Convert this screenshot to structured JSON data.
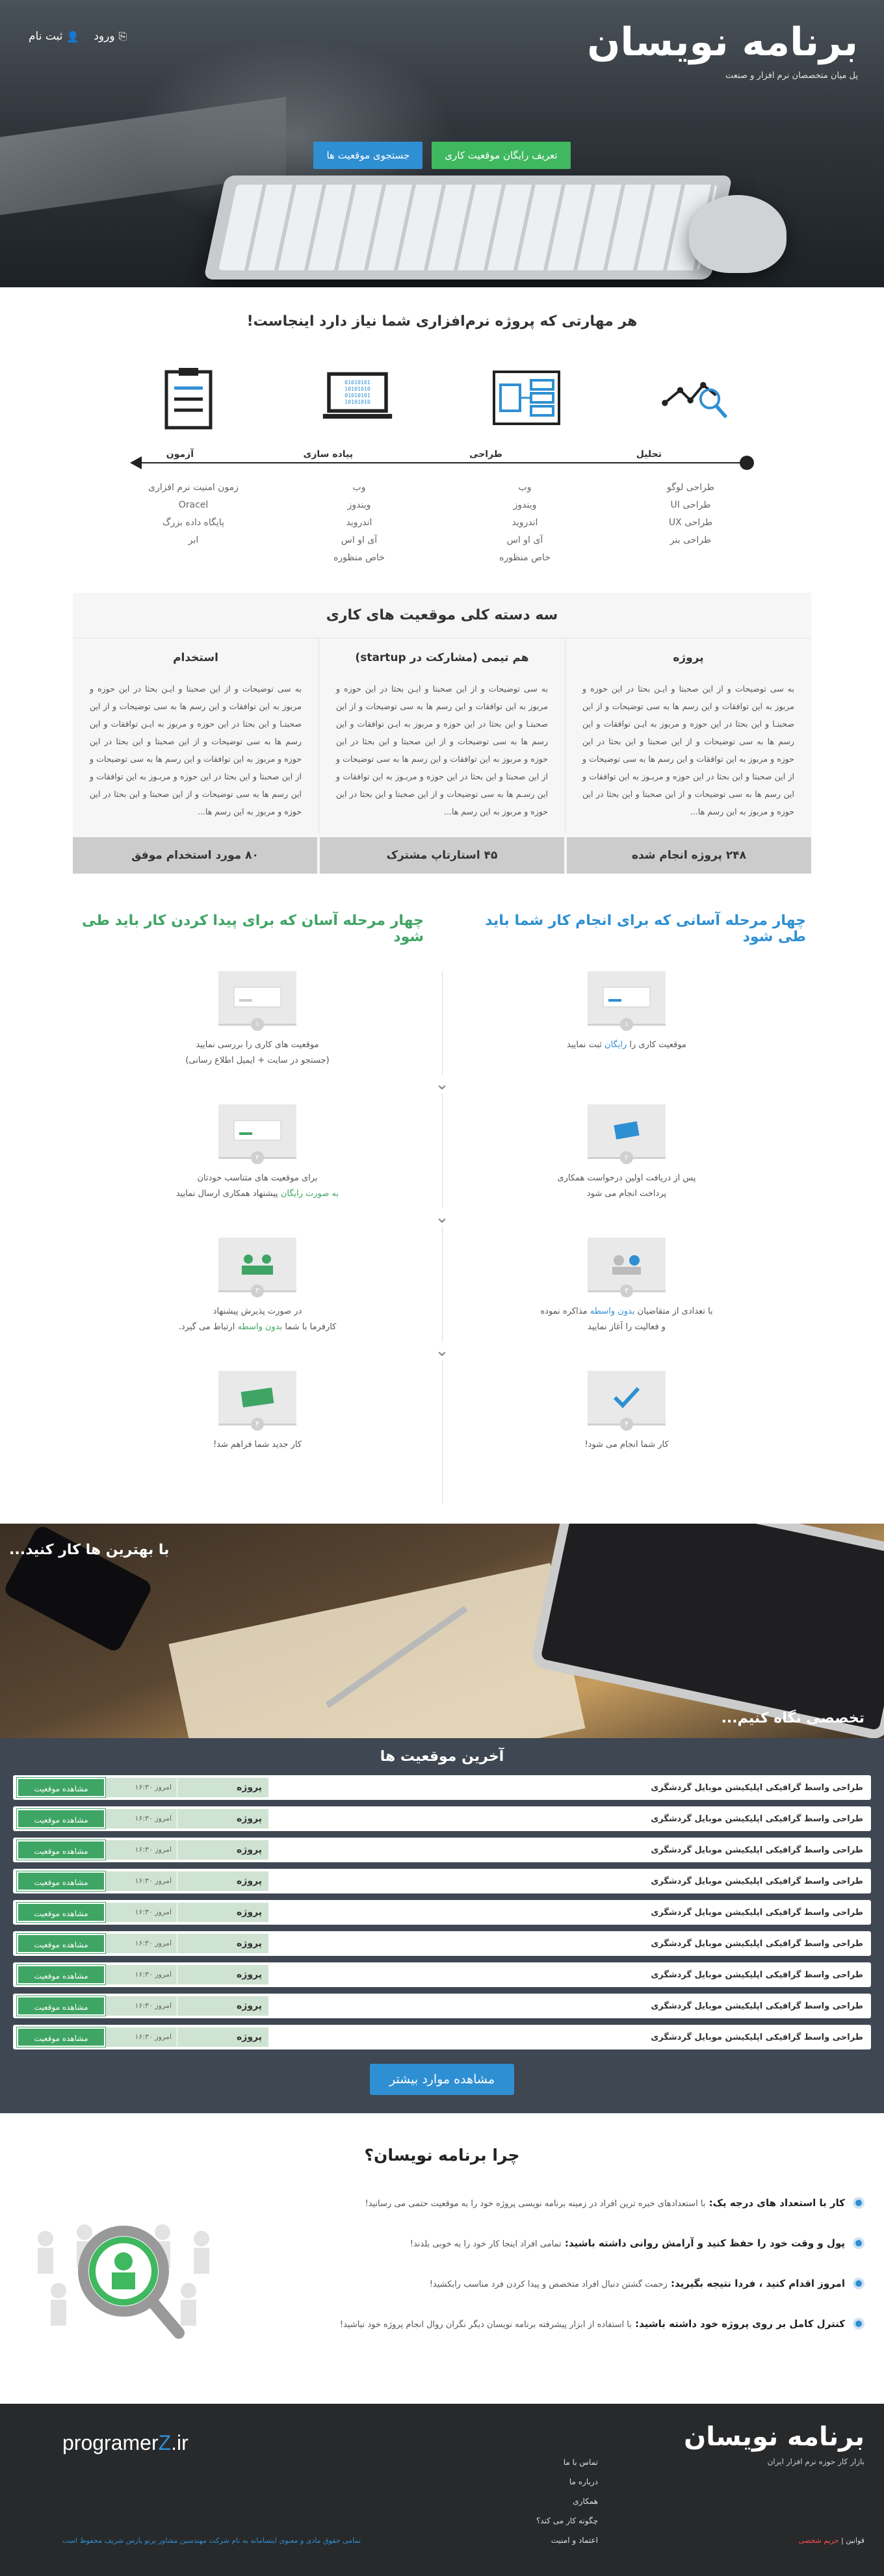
{
  "header": {
    "logo": "برنامه نویسان",
    "tagline": "پل میان متخصصان نرم افزار و صنعت",
    "login": "ورود",
    "register": "ثبت نام",
    "btn_define": "تعریف رایگان موقعیت کاری",
    "btn_search": "جستجوی موقعیت ها"
  },
  "skills": {
    "title": "هر مهارتی که پروژه نرم‌افزاری شما نیاز دارد اینجاست!",
    "stages": [
      "تحلیل",
      "طراحی",
      "پیاده سازی",
      "آزمون"
    ],
    "columns": [
      [
        "طراحی لوگو",
        "طراحی UI",
        "طراحی UX",
        "طراحی بنر"
      ],
      [
        "وب",
        "ویندوز",
        "اندروید",
        "آی او اس",
        "خاص منظوره"
      ],
      [
        "وب",
        "ویندوز",
        "اندروید",
        "آی او اس",
        "خاص منظوره"
      ],
      [
        "زمون امنیت نرم افزاری",
        "Oracel",
        "پایگاه داده بزرگ",
        "ابر"
      ]
    ]
  },
  "categories": {
    "title": "سه دسته کلی موقعیت های کاری",
    "items": [
      {
        "title": "پروژه",
        "text": "به سی توضیحات و از این صحبتا و ایـن بحثا در این حوزه و مربوز به این توافقات و این رسم ها به سی توضیحات و از این صحبتـا و این بحثا در این حوزه و مربوز به ایـن توافقات و این رسم ها به سی توضیحات و از این صحبتا و این بحثا در این حوزه و مربوز به این توافقات و این رسم ها به سی توضیحات و از این صحبتا و این بحثا در این حوزه و مربـوز به این توافقات و این رسم ها به سی توضیحات و از این صحبتا و این بحثا در این حوزه و مربوز به این رسم ها..."
      },
      {
        "title": "هم تیمی (مشارکت در startup)",
        "text": "به سی توضیحات و از این صحبتا و ایـن بحثا در این حوزه و مربوز به این توافقات و این رسم ها به سی توضیحات و از این صحبتـا و این بحثا در این حوزه و مربوز به ایـن توافقات و این رسم ها به سی توضیحات و از این صحبتا و این بحثا در این حوزه و مربوز به این توافقات و این رسم ها به سی توضیحات و از این صحبتا و این بحثا در این حوزه و مربـوز به این توافقات و این رسـم ها به سی توضیحات و از این صحبتا و این بحثا در این حوزه و مربوز به این رسم ها..."
      },
      {
        "title": "استخدام",
        "text": "به سی توضیحات و از این صحبتا و ایـن بحثا در این حوزه و مربوز به این توافقات و این رسم ها به سی توضیحات و از این صحبتـا و این بحثا در این حوزه و مربوز به ایـن توافقات و این رسم ها به سی توضیحات و از این صحبتا و این بحثا در این حوزه و مربوز به این توافقات و این رسم ها به سی توضیحات و از این صحبتا و این بحثا در این حوزه و مربـوز به این توافقات و این رسم ها به سی توضیحات و از این صحبتا و این بحثا در این حوزه و مربوز به این رسم ها..."
      }
    ],
    "stats": [
      "۲۴۸ پروژه انجام شده",
      "۴۵ استارتاپ مشترک",
      "۸۰ مورد استخدام موفق"
    ]
  },
  "steps": {
    "title_right": "چهار مرحله آسانی که برای انجام کار شما باید طی شود",
    "title_left": "چهار مرحله آسان که  برای پیدا کردن کار باید طی شود",
    "right": [
      {
        "num": "۱",
        "pre": "موقعیت کاری را ",
        "hl": "رایگان",
        "post": " ثبت نمایید"
      },
      {
        "num": "۲",
        "pre": "پس از دریافت اولین درخواست همکاری\nپرداخت انجام می شود",
        "hl": "",
        "post": ""
      },
      {
        "num": "۳",
        "pre": "با تعدادی از متقاضیان ",
        "hl": "بدون واسطه",
        "post": " مذاکره نموده\nو فعالیت را آغاز نمایید"
      },
      {
        "num": "۴",
        "pre": "کار شما انجام می شود!",
        "hl": "",
        "post": ""
      }
    ],
    "left": [
      {
        "num": "۱",
        "pre": "موقعیت های کاری را بررسی نمایید\n(جستجو در سایت + ایمیل اطلاع رسانی)",
        "hl": "",
        "post": ""
      },
      {
        "num": "۲",
        "pre": "برای موقعیت های متناسب خودتان\n",
        "hl": "به صورت رایگان",
        "post": " پیشنهاد همکاری ارسال نمایید"
      },
      {
        "num": "۳",
        "pre": "در صورت پذیرش پیشنهاد\nکارفرما با شما ",
        "hl": "بدون واسطه",
        "post": " ارتباط می گیرد."
      },
      {
        "num": "۴",
        "pre": "کار جدید شما فراهم شد!",
        "hl": "",
        "post": ""
      }
    ]
  },
  "banner": {
    "cap_top": "با بهترین ها کار کنید...",
    "cap_bottom": "تخصصی نگاه کنیم..."
  },
  "latest": {
    "title": "آخرین موقعیت ها",
    "view_label": "مشاهده موقعیت",
    "more": "مشاهده موارد بیشتر",
    "jobs": [
      {
        "title": "طراحی واسط گرافیکی اپلیکیشن موبایل گردشگری",
        "type": "پروژه",
        "date": "امروز ۱۶:۳۰"
      },
      {
        "title": "طراحی واسط گرافیکی اپلیکیشن موبایل گردشگری",
        "type": "پروژه",
        "date": "امروز ۱۶:۳۰"
      },
      {
        "title": "طراحی واسط گرافیکی اپلیکیشن موبایل گردشگری",
        "type": "پروژه",
        "date": "امروز ۱۶:۳۰"
      },
      {
        "title": "طراحی واسط گرافیکی اپلیکیشن موبایل گردشگری",
        "type": "پروژه",
        "date": "امروز ۱۶:۳۰"
      },
      {
        "title": "طراحی واسط گرافیکی اپلیکیشن موبایل گردشگری",
        "type": "پروژه",
        "date": "امروز ۱۶:۳۰"
      },
      {
        "title": "طراحی واسط گرافیکی اپلیکیشن موبایل گردشگری",
        "type": "پروژه",
        "date": "امروز ۱۶:۳۰"
      },
      {
        "title": "طراحی واسط گرافیکی اپلیکیشن موبایل گردشگری",
        "type": "پروژه",
        "date": "امروز ۱۶:۳۰"
      },
      {
        "title": "طراحی واسط گرافیکی اپلیکیشن موبایل گردشگری",
        "type": "پروژه",
        "date": "امروز ۱۶:۳۰"
      },
      {
        "title": "طراحی واسط گرافیکی اپلیکیشن موبایل گردشگری",
        "type": "پروژه",
        "date": "امروز ۱۶:۳۰"
      }
    ]
  },
  "why": {
    "title": "چرا برنامه نویسان؟",
    "items": [
      {
        "bold": "کار با استعداد های درجه یک: ",
        "text": "با استعدادهای خبره ترین افراد در زمینه برنامه نویسی پروژه خود را به موقعیت حتمی می رسانید!"
      },
      {
        "bold": "پول و وقت خود را حفظ کنید و آرامش روانی داشته باشید: ",
        "text": "تمامی افراد اینجا کار خود را به خوبی بلدند!"
      },
      {
        "bold": "امروز اقدام کنید ، فردا نتیجه بگیرید: ",
        "text": "زحمت گشتن دنبال افراد متخصص و پیدا کردن فرد مناسب رابکشید!"
      },
      {
        "bold": "کنترل کامل بر روی پروژه خود داشته باشید: ",
        "text": "با استفاده از ابزار پیشرفته برنامه نویسان دیگر نگران روال انجام پروژه خود نباشید!"
      }
    ]
  },
  "footer": {
    "logo": "برنامه نویسان",
    "tagline": "بازار کار حوزه نرم افزار ایران",
    "links": [
      "تماس با ما",
      "درباره ما",
      "همکاری",
      "چگونه کار می کند؟",
      "اعتماد و امنیت"
    ],
    "brand_a": "programer",
    "brand_z": "Z",
    "brand_b": ".ir",
    "rules_a": "قوانین",
    "rules_b": "حریم شخصی",
    "copyright": "تمامی حقوق مادی و معنوی اینسامانه به نام شرکت مهندسین مشاور پرتو پارس شریف محفوظ است"
  },
  "colors": {
    "green": "#3fb85f",
    "blue": "#2f8fd3",
    "dark": "#3e4752"
  }
}
